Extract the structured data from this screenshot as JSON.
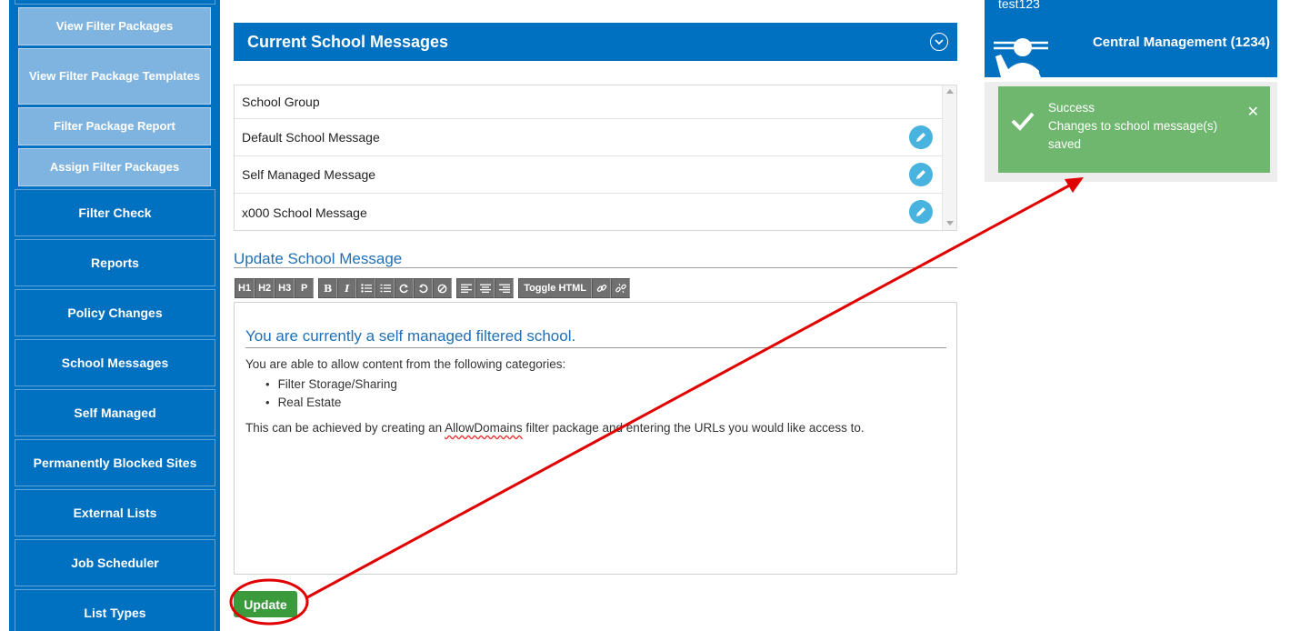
{
  "sidebar": {
    "sub_items": [
      {
        "label": "View Filter Packages"
      },
      {
        "label": "View Filter Package Templates"
      },
      {
        "label": "Filter Package Report"
      },
      {
        "label": "Assign Filter Packages"
      }
    ],
    "items": [
      {
        "label": "Filter Check"
      },
      {
        "label": "Reports"
      },
      {
        "label": "Policy Changes"
      },
      {
        "label": "School Messages"
      },
      {
        "label": "Self Managed"
      },
      {
        "label": "Permanently Blocked Sites"
      },
      {
        "label": "External Lists"
      },
      {
        "label": "Job Scheduler"
      },
      {
        "label": "List Types"
      }
    ]
  },
  "panel": {
    "title": "Current School Messages",
    "messages": [
      {
        "label": "School Group"
      },
      {
        "label": "Default School Message"
      },
      {
        "label": "Self Managed Message"
      },
      {
        "label": "x000 School Message"
      }
    ]
  },
  "update_section": {
    "title": "Update School Message",
    "toolbar": {
      "headings": [
        "H1",
        "H2",
        "H3",
        "P"
      ],
      "toggle_html": "Toggle HTML"
    },
    "editor": {
      "heading": "You are currently a self managed filtered school.",
      "intro": "You are able to allow content from the following categories:",
      "categories": [
        "Filter Storage/Sharing",
        "Real Estate"
      ],
      "footer_before": "This can be achieved by creating an ",
      "footer_link": "AllowDomains",
      "footer_after": " filter package and entering the URLs you would like access to."
    },
    "update_label": "Update"
  },
  "user": {
    "name": "test123",
    "organization": "Central Management (1234)"
  },
  "toast": {
    "title": "Success",
    "message_line1": "Changes to school message(s)",
    "message_line2": "saved",
    "color": "#6fb76f"
  },
  "colors": {
    "brand_blue": "#0070c0",
    "annotation_red": "#e00000"
  }
}
